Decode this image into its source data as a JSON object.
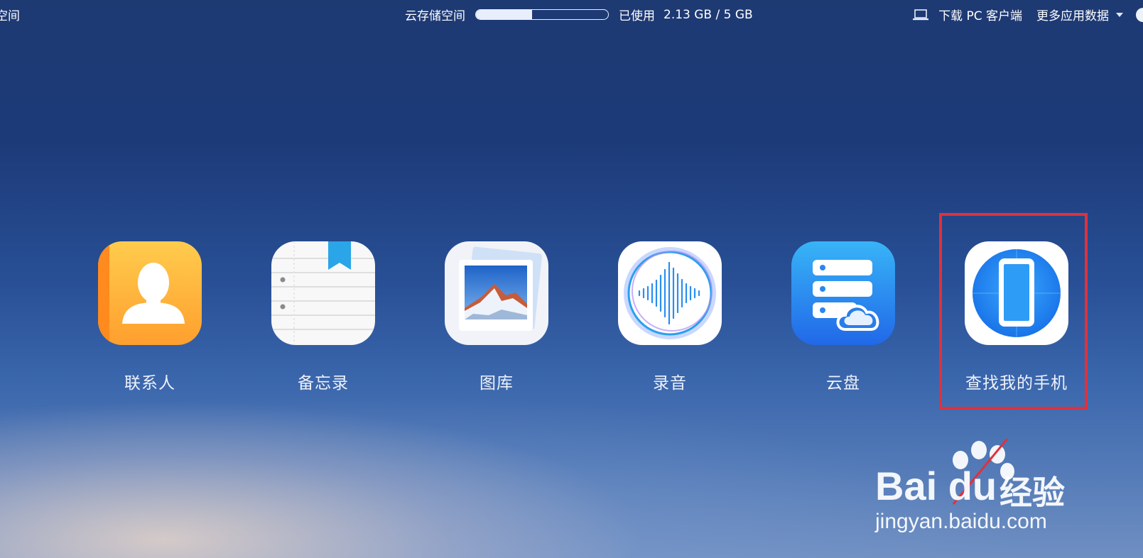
{
  "topbar": {
    "left_fragment": "空间",
    "storage_label": "云存储空间",
    "storage_used_fraction": 0.426,
    "used_label": "已使用",
    "used_value": "2.13 GB / 5 GB",
    "download_label": "下载 PC 客户端",
    "more_label": "更多应用数据"
  },
  "apps": [
    {
      "label": "联系人",
      "icon": "contacts-icon"
    },
    {
      "label": "备忘录",
      "icon": "notes-icon"
    },
    {
      "label": "图库",
      "icon": "gallery-icon"
    },
    {
      "label": "录音",
      "icon": "recorder-icon"
    },
    {
      "label": "云盘",
      "icon": "cloud-drive-icon"
    },
    {
      "label": "查找我的手机",
      "icon": "find-phone-icon"
    }
  ],
  "watermark": {
    "brand": "Bai  du",
    "product": "经验",
    "url": "jingyan.baidu.com"
  },
  "colors": {
    "highlight": "#e0313b",
    "contacts": "#ffb43a",
    "cloud": "#2f7ff0",
    "find_phone": "#1f8cf0"
  }
}
